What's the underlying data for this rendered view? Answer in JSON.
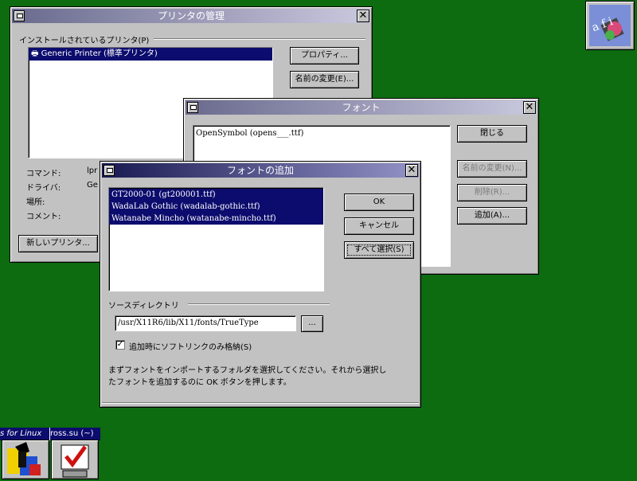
{
  "printer_window": {
    "title": "プリンタの管理",
    "installed_label": "インストールされているプリンタ(P)",
    "printers": [
      {
        "name": "Generic Printer (標準プリンタ)"
      }
    ],
    "properties_button": "プロパティ...",
    "rename_button": "名前の変更(E)...",
    "command_label": "コマンド:",
    "command_value": "lpr",
    "driver_label": "ドライバ:",
    "driver_value": "Ge",
    "location_label": "場所:",
    "comment_label": "コメント:",
    "new_printer_button": "新しいプリンタ..."
  },
  "font_window": {
    "title": "フォント",
    "fonts": [
      {
        "name": "OpenSymbol (opens___.ttf)"
      }
    ],
    "close_button": "閉じる",
    "rename_button": "名前の変更(N)...",
    "delete_button": "削除(R)...",
    "add_button": "追加(A)..."
  },
  "add_font_dialog": {
    "title": "フォントの追加",
    "fonts": [
      {
        "name": "GT2000-01 (gt200001.ttf)"
      },
      {
        "name": "WadaLab Gothic (wadalab-gothic.ttf)"
      },
      {
        "name": "Watanabe Mincho (watanabe-mincho.ttf)"
      }
    ],
    "ok_button": "OK",
    "cancel_button": "キャンセル",
    "select_all_button": "すべて選択(S)",
    "source_dir_label": "ソースディレクトリ",
    "source_dir_value": "/usr/X11R6/lib/X11/fonts/TrueType",
    "browse_button": "...",
    "symlink_checkbox_checked": true,
    "symlink_checkbox_mark": "✓",
    "symlink_label": "追加時にソフトリンクのみ格納(S)",
    "instruction_line1": "まずフォントをインポートするフォルダを選択してください。それから選択し",
    "instruction_line2": "たフォントを追加するのに OK ボタンを押します。"
  },
  "taskbar": {
    "label1": "s for Linux",
    "label2": "ross.su (~)"
  },
  "colors": {
    "desktop": "#0d6b10",
    "selection": "#0c0c6e"
  }
}
